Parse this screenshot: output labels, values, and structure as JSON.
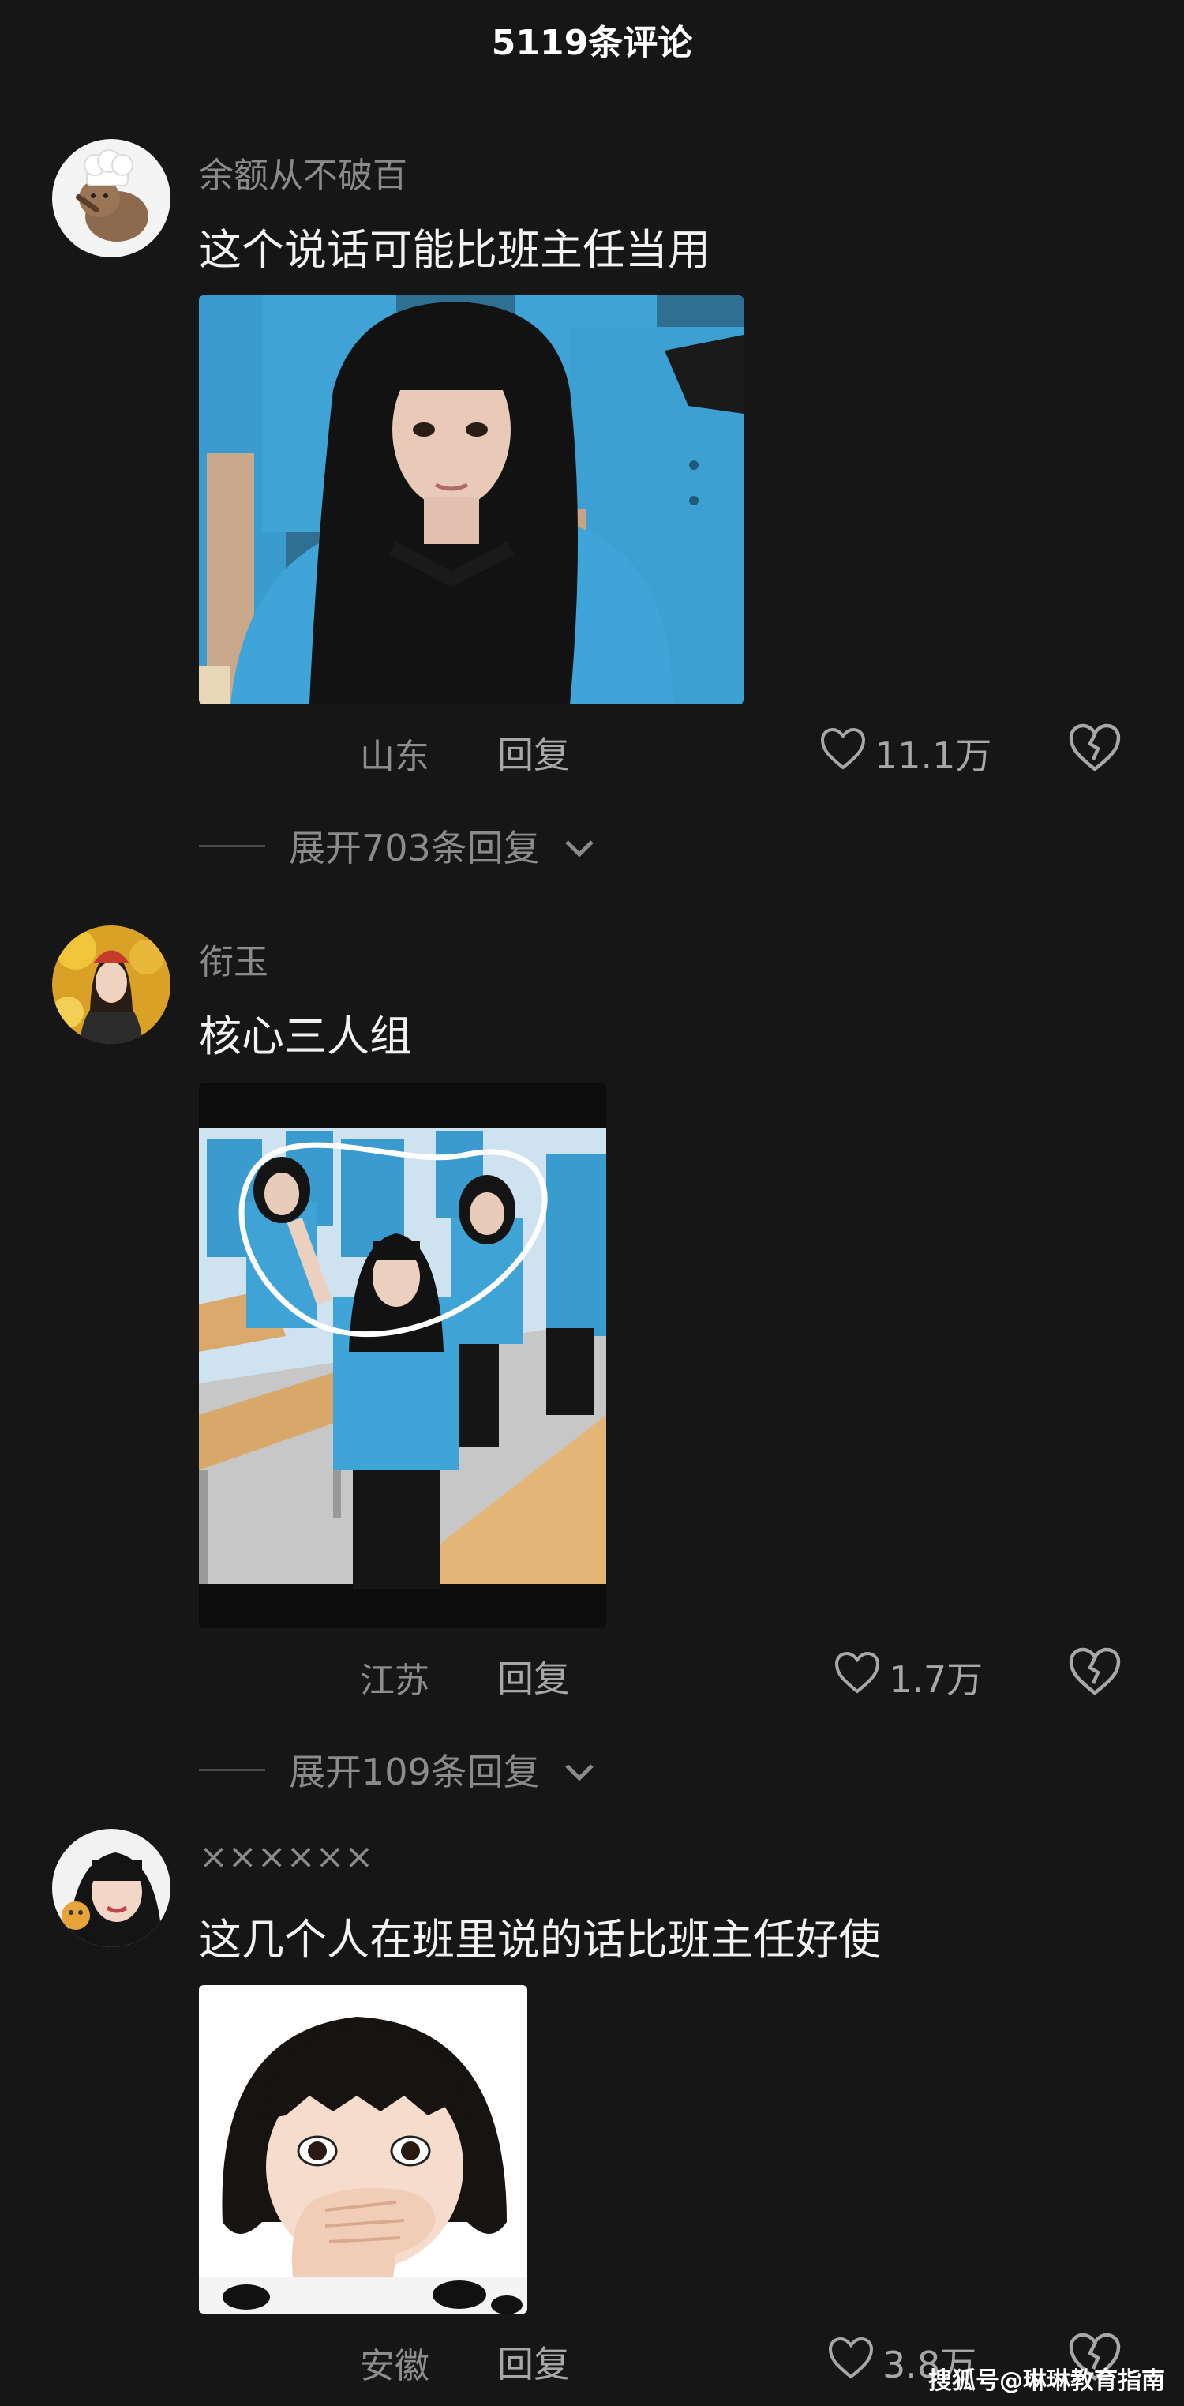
{
  "header": {
    "title": "5119条评论"
  },
  "comments": [
    {
      "username": "余额从不破百",
      "text": "这个说话可能比班主任当用",
      "location": "山东",
      "reply_label": "回复",
      "likes": "11.1万",
      "expand_label": "展开703条回复"
    },
    {
      "username": "衔玉",
      "text": "核心三人组",
      "location": "江苏",
      "reply_label": "回复",
      "likes": "1.7万",
      "expand_label": "展开109条回复"
    },
    {
      "username": "××××××",
      "text": "这几个人在班里说的话比班主任好使",
      "location": "安徽",
      "reply_label": "回复",
      "likes": "3.8万"
    }
  ],
  "watermark": "搜狐号@琳琳教育指南",
  "colors": {
    "background": "#161616",
    "muted_text": "#8a8a8a",
    "uniform_blue": "#3a9bcf"
  },
  "icons": {
    "like": "heart-outline-icon",
    "dislike": "broken-heart-icon",
    "expand": "chevron-down-icon"
  }
}
